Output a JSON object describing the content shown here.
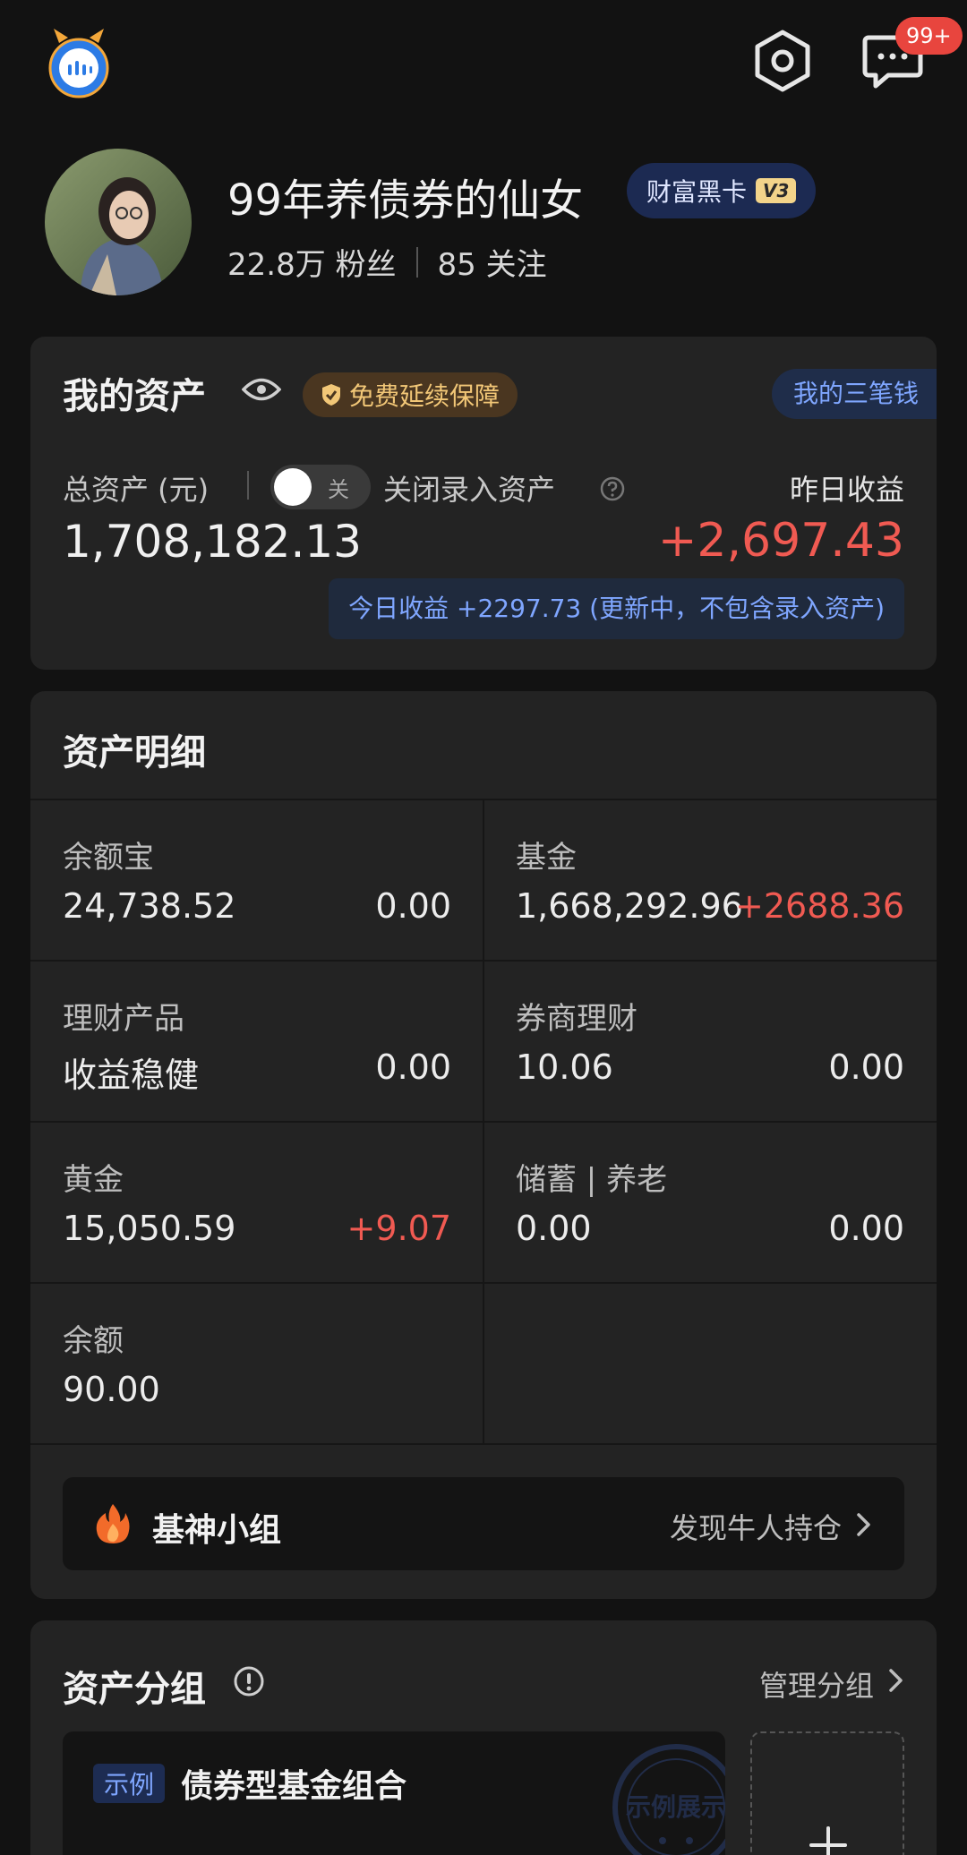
{
  "header": {
    "message_badge": "99+",
    "icons": [
      "app-logo-icon",
      "settings-icon",
      "message-icon"
    ]
  },
  "profile": {
    "nickname": "99年养债券的仙女",
    "vip_label": "财富黑卡",
    "vip_level": "V3",
    "followers_count": "22.8万",
    "followers_label": "粉丝",
    "following_count": "85",
    "following_label": "关注"
  },
  "my_assets": {
    "title": "我的资产",
    "guarantee_label": "免费延续保障",
    "three_money_label": "我的三笔钱",
    "total_label": "总资产 (元)",
    "toggle_label": "关",
    "close_entry_label": "关闭录入资产",
    "yesterday_label": "昨日收益",
    "total_value": "1,708,182.13",
    "yesterday_value": "+2,697.43",
    "today_earnings": "今日收益 +2297.73 (更新中，不包含录入资产)"
  },
  "asset_details": {
    "title": "资产明细",
    "items": [
      {
        "name": "余额宝",
        "value": "24,738.52",
        "change": "0.00"
      },
      {
        "name": "基金",
        "value": "1,668,292.96",
        "change": "+2688.36"
      },
      {
        "name": "理财产品",
        "value": "收益稳健",
        "change": "0.00"
      },
      {
        "name": "券商理财",
        "value": "10.06",
        "change": "0.00"
      },
      {
        "name": "黄金",
        "value": "15,050.59",
        "change": "+9.07"
      },
      {
        "name": "储蓄 | 养老",
        "value": "0.00",
        "change": "0.00"
      },
      {
        "name": "余额",
        "value": "90.00",
        "change": ""
      }
    ],
    "fund_group_title": "基神小组",
    "fund_group_link": "发现牛人持仓"
  },
  "asset_groups": {
    "title": "资产分组",
    "manage_link": "管理分组",
    "example_tag": "示例",
    "example_title": "债券型基金组合",
    "stamp_text": "示例展示"
  },
  "colors": {
    "background": "#121212",
    "card": "#232323",
    "gain_red": "#f05a52",
    "link_blue": "#7fa6ff",
    "gold": "#f2c777"
  }
}
